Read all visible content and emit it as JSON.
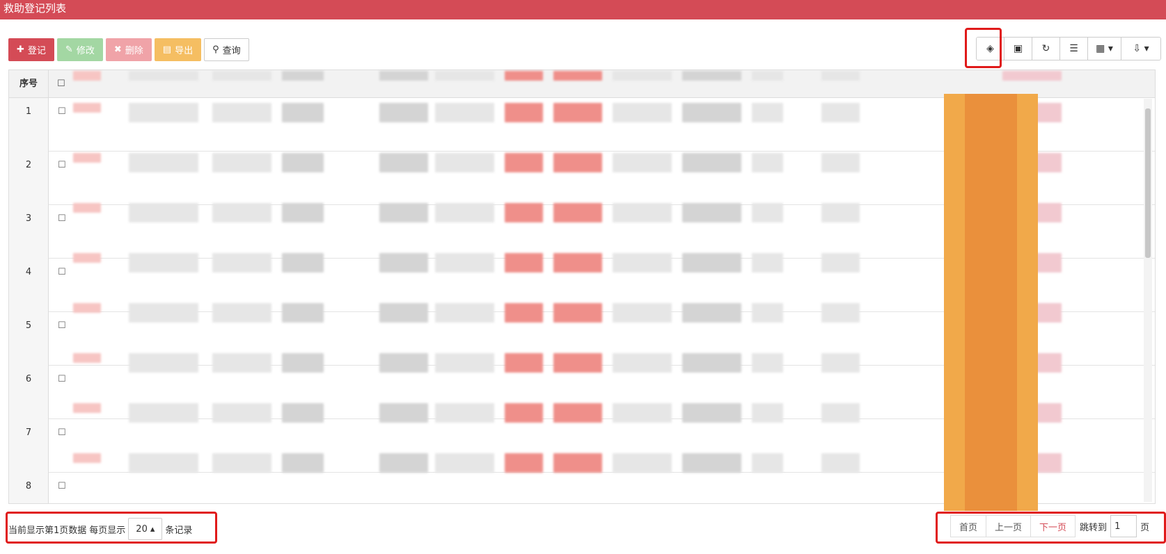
{
  "title": "救助登记列表",
  "toolbar": {
    "add": "登记",
    "edit": "修改",
    "delete": "删除",
    "export": "导出",
    "search": "查询"
  },
  "table": {
    "header_no": "序号",
    "rows": [
      "1",
      "2",
      "3",
      "4",
      "5",
      "6",
      "7",
      "8"
    ]
  },
  "footer": {
    "current": "当前显示第1页数据",
    "per_page_prefix": "每页显示",
    "page_size": "20",
    "per_page_suffix": "条记录"
  },
  "pager": {
    "first": "首页",
    "prev": "上一页",
    "next": "下一页",
    "jump_label": "跳转到",
    "jump_value": "1",
    "page_unit": "页"
  },
  "colors": {
    "brand": "#d44b56",
    "highlight": "#e01a1a",
    "orange_column": "#f1a94a"
  }
}
